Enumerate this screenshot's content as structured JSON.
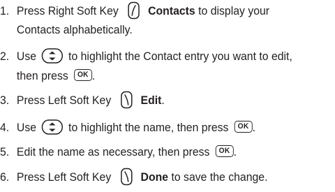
{
  "steps": [
    {
      "number": "1.",
      "text_a": "Press Right Soft Key",
      "key_label": "Contacts",
      "text_b": "to display your",
      "text_c": "Contacts alphabetically."
    },
    {
      "number": "2.",
      "text_a": "Use",
      "text_b": "to highlight the Contact entry you want to edit,",
      "text_c": "then press",
      "text_d": "."
    },
    {
      "number": "3.",
      "text_a": "Press Left Soft Key",
      "key_label": "Edit",
      "text_b": "."
    },
    {
      "number": "4.",
      "text_a": "Use",
      "text_b": "to highlight the name, then press",
      "text_c": "."
    },
    {
      "number": "5.",
      "text_a": "Edit the name as necessary, then press",
      "text_b": "."
    },
    {
      "number": "6.",
      "text_a": "Press Left Soft Key",
      "key_label": "Done",
      "text_b": "to save the change."
    }
  ],
  "keys": {
    "ok_label": "OK"
  },
  "icons": {
    "right_soft_key": "right-soft-key-icon",
    "left_soft_key": "left-soft-key-icon",
    "nav_key": "navigation-key-icon",
    "ok_key": "ok-key-icon"
  }
}
